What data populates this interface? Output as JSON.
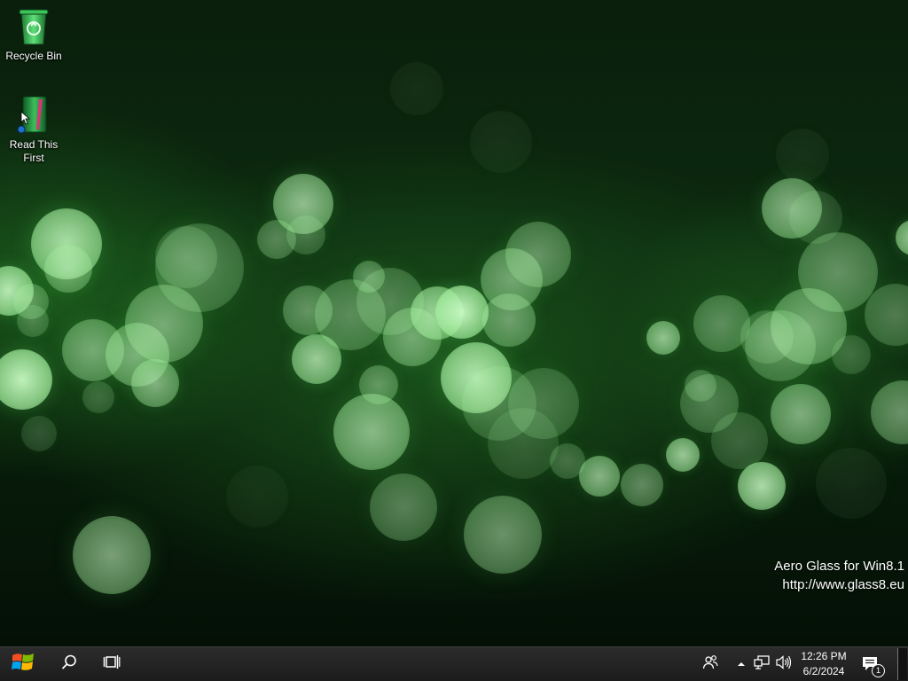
{
  "desktop": {
    "icons": [
      {
        "label": "Recycle Bin",
        "icon": "recycle-bin-icon"
      },
      {
        "label": "Read This First",
        "icon": "read-this-first-icon"
      }
    ],
    "watermark": {
      "line1": "Aero Glass for Win8.1",
      "line2": "http://www.glass8.eu"
    }
  },
  "taskbar": {
    "start_icon": "windows-logo-icon",
    "search_icon": "search-icon",
    "taskview_icon": "task-view-icon",
    "tray": {
      "people_icon": "people-icon",
      "chevron_icon": "chevron-up-icon",
      "network_icon": "network-icon",
      "volume_icon": "volume-icon",
      "notification_count": "1"
    },
    "clock": {
      "time": "12:26 PM",
      "date": "6/2/2024"
    }
  },
  "colors": {
    "bubble": "#b8f0b0",
    "taskbar": "#1e1e1e",
    "accent_green": "#2fa84a"
  }
}
